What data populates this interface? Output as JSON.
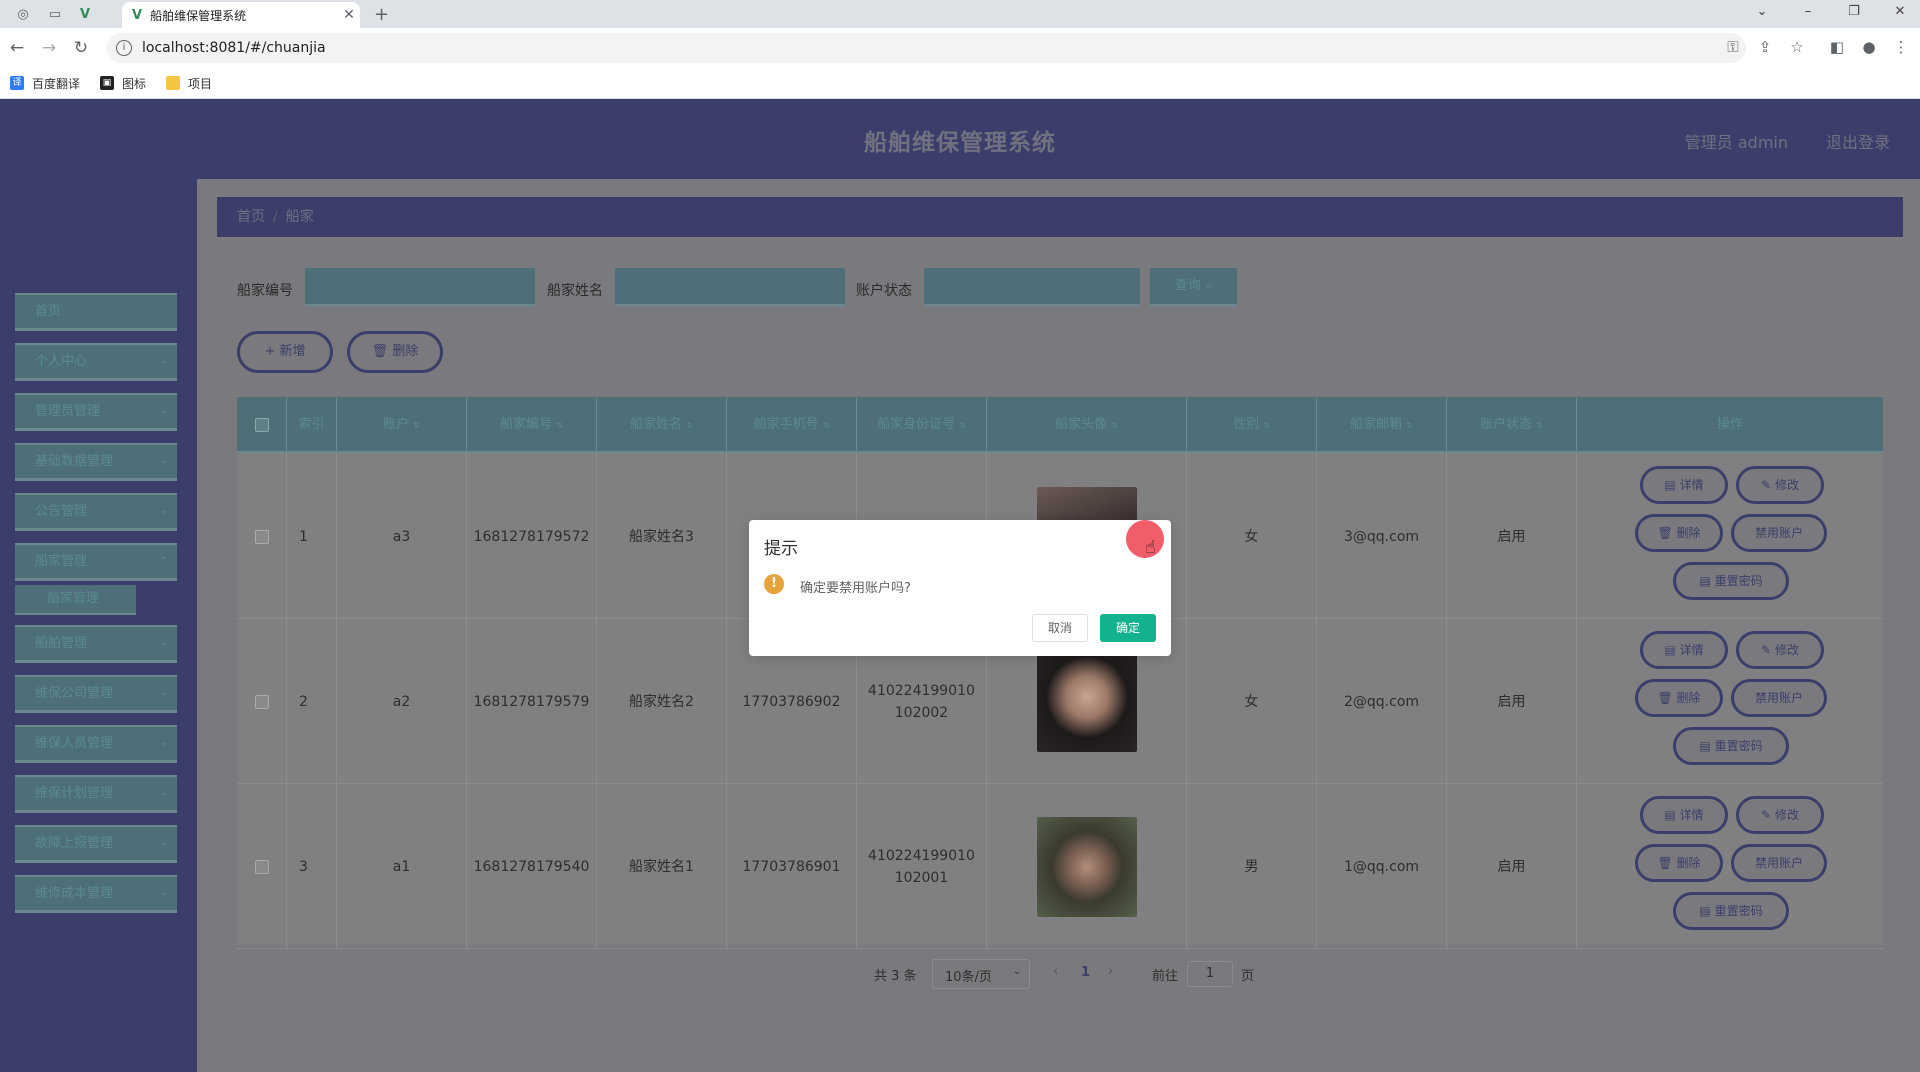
{
  "browser": {
    "tab_title": "船舶维保管理系统",
    "url": "localhost:8081/#/chuanjia",
    "bookmarks": [
      "百度翻译",
      "图标",
      "项目"
    ]
  },
  "header": {
    "title": "船舶维保管理系统",
    "user": "管理员 admin",
    "logout": "退出登录"
  },
  "sidebar": {
    "items": [
      {
        "label": "首页"
      },
      {
        "label": "个人中心"
      },
      {
        "label": "管理员管理"
      },
      {
        "label": "基础数据管理"
      },
      {
        "label": "公告管理"
      },
      {
        "label": "船家管理"
      },
      {
        "label": "船舶管理"
      },
      {
        "label": "维保公司管理"
      },
      {
        "label": "维保人员管理"
      },
      {
        "label": "维保计划管理"
      },
      {
        "label": "故障上报管理"
      },
      {
        "label": "维修成本管理"
      }
    ],
    "active_sub": "船家管理"
  },
  "breadcrumb": {
    "home": "首页",
    "sep": "/",
    "current": "船家"
  },
  "filters": {
    "label1": "船家编号",
    "label2": "船家姓名",
    "label3": "账户状态",
    "query": "查询"
  },
  "actions": {
    "add": "+ 新增",
    "delete": "删除"
  },
  "table": {
    "columns": [
      "索引",
      "账户",
      "船家编号",
      "船家姓名",
      "船家手机号",
      "船家身份证号",
      "船家头像",
      "性别",
      "船家邮箱",
      "账户状态",
      "操作"
    ],
    "rows": [
      {
        "index": "1",
        "account": "a3",
        "code": "1681278179572",
        "name": "船家姓名3",
        "phone": "",
        "idcard": "",
        "gender": "女",
        "email": "3@qq.com",
        "status": "启用"
      },
      {
        "index": "2",
        "account": "a2",
        "code": "1681278179579",
        "name": "船家姓名2",
        "phone": "17703786902",
        "idcard": "410224199010102002",
        "gender": "女",
        "email": "2@qq.com",
        "status": "启用"
      },
      {
        "index": "3",
        "account": "a1",
        "code": "1681278179540",
        "name": "船家姓名1",
        "phone": "17703786901",
        "idcard": "410224199010102001",
        "gender": "男",
        "email": "1@qq.com",
        "status": "启用"
      }
    ],
    "ops": {
      "detail": "详情",
      "edit": "修改",
      "delete": "删除",
      "disable": "禁用账户",
      "reset": "重置密码"
    }
  },
  "pager": {
    "total": "共 3 条",
    "size": "10条/页",
    "page": "1",
    "goto": "前往",
    "goto_value": "1",
    "page_unit": "页"
  },
  "dialog": {
    "title": "提示",
    "message": "确定要禁用账户吗?",
    "cancel": "取消",
    "confirm": "确定"
  }
}
